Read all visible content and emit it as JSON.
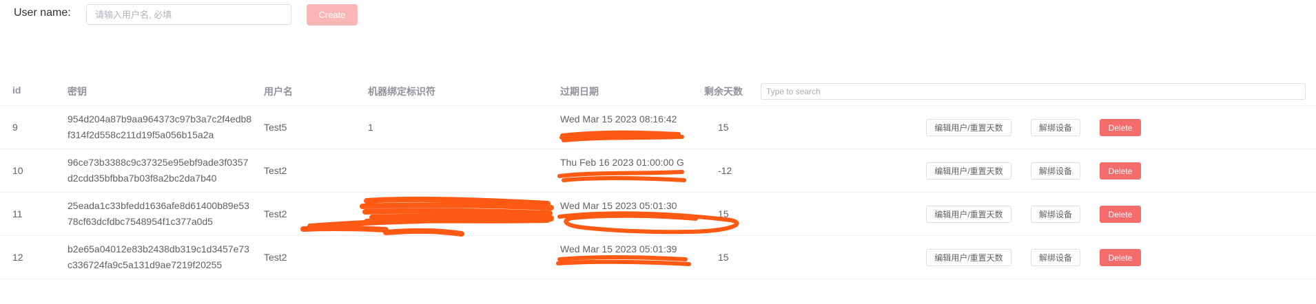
{
  "form": {
    "label": "User name:",
    "placeholder": "请输入用户名, 必填",
    "create_label": "Create"
  },
  "table": {
    "headers": {
      "id": "id",
      "key": "密钥",
      "username": "用户名",
      "binding": "机器绑定标识符",
      "expiry": "过期日期",
      "days": "剩余天数"
    },
    "search_placeholder": "Type to search",
    "action_labels": {
      "edit": "编辑用户/重置天数",
      "unbind": "解绑设备",
      "delete": "Delete"
    },
    "rows": [
      {
        "id": "9",
        "key": "954d204a87b9aa964373c97b3a7c2f4edb8f314f2d558c211d19f5a056b15a2a",
        "username": "Test5",
        "binding": "1",
        "expiry": "Wed Mar 15 2023 08:16:42",
        "days": "15"
      },
      {
        "id": "10",
        "key": "96ce73b3388c9c37325e95ebf9ade3f0357d2cdd35bfbba7b03f8a2bc2da7b40",
        "username": "Test2",
        "binding": "",
        "expiry": "Thu Feb 16 2023 01:00:00 G",
        "days": "-12"
      },
      {
        "id": "11",
        "key": "25eada1c33bfedd1636afe8d61400b89e5378cf63dcfdbc7548954f1c377a0d5",
        "username": "Test2",
        "binding": "",
        "expiry": "Wed Mar 15 2023 05:01:30",
        "days": "15"
      },
      {
        "id": "12",
        "key": "b2e65a04012e83b2438db319c1d3457e73c336724fa9c5a131d9ae7219f20255",
        "username": "Test2",
        "binding": "",
        "expiry": "Wed Mar 15 2023 05:01:39",
        "days": "15"
      }
    ]
  },
  "colors": {
    "redaction": "#ff5a14",
    "delete_button": "#f56c6c",
    "create_button_disabled": "#fab6b6",
    "header_text": "#909399",
    "body_text": "#606266"
  }
}
